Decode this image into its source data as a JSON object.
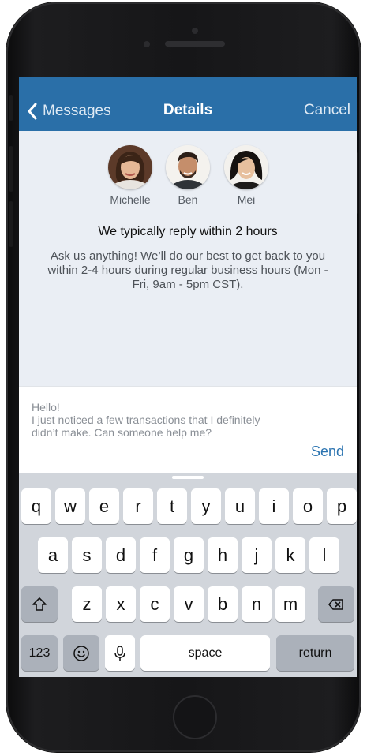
{
  "nav": {
    "back_label": "Messages",
    "title": "Details",
    "cancel_label": "Cancel"
  },
  "agents": [
    {
      "name": "Michelle"
    },
    {
      "name": "Ben"
    },
    {
      "name": "Mei"
    }
  ],
  "info": {
    "title": "We typically reply within 2 hours",
    "description": "Ask us anything! We’ll do our best to get back to you within 2-4 hours during regular business hours (Mon - Fri, 9am - 5pm CST)."
  },
  "composer": {
    "message": "Hello!\nI just noticed a few transactions that I definitely didn’t make. Can someone help me?",
    "send_label": "Send"
  },
  "keyboard": {
    "row1": [
      "q",
      "w",
      "e",
      "r",
      "t",
      "y",
      "u",
      "i",
      "o",
      "p"
    ],
    "row2": [
      "a",
      "s",
      "d",
      "f",
      "g",
      "h",
      "j",
      "k",
      "l"
    ],
    "row3": [
      "z",
      "x",
      "c",
      "v",
      "b",
      "n",
      "m"
    ],
    "numbers_label": "123",
    "space_label": "space",
    "return_label": "return",
    "icons": [
      "shift-icon",
      "delete-icon",
      "emoji-icon",
      "microphone-icon"
    ]
  },
  "colors": {
    "nav_bar": "#2a6fa8",
    "accent": "#2a73b0",
    "screen_bg": "#eaeef4",
    "keyboard_bg": "#d1d5db"
  }
}
